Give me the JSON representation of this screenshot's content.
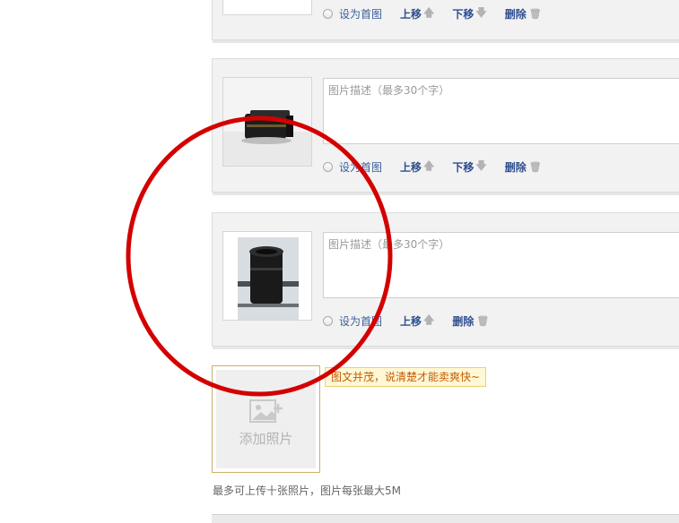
{
  "photos": [
    {
      "set_cover_label": "设为首图",
      "move_up_label": "上移",
      "move_down_label": "下移",
      "delete_label": "删除"
    },
    {
      "description_placeholder": "图片描述（最多30个字）",
      "set_cover_label": "设为首图",
      "move_up_label": "上移",
      "move_down_label": "下移",
      "delete_label": "删除"
    },
    {
      "description_placeholder": "图片描述（最多30个字）",
      "set_cover_label": "设为首图",
      "move_up_label": "上移",
      "delete_label": "删除"
    }
  ],
  "add_photo": {
    "label": "添加照片"
  },
  "tip": "图文并茂，说清楚才能卖爽快~",
  "limit_note": "最多可上传十张照片，图片每张最大5M",
  "colors": {
    "annotation_circle": "#d40000",
    "link": "#2f4f8f",
    "tip_text": "#c65b00"
  }
}
